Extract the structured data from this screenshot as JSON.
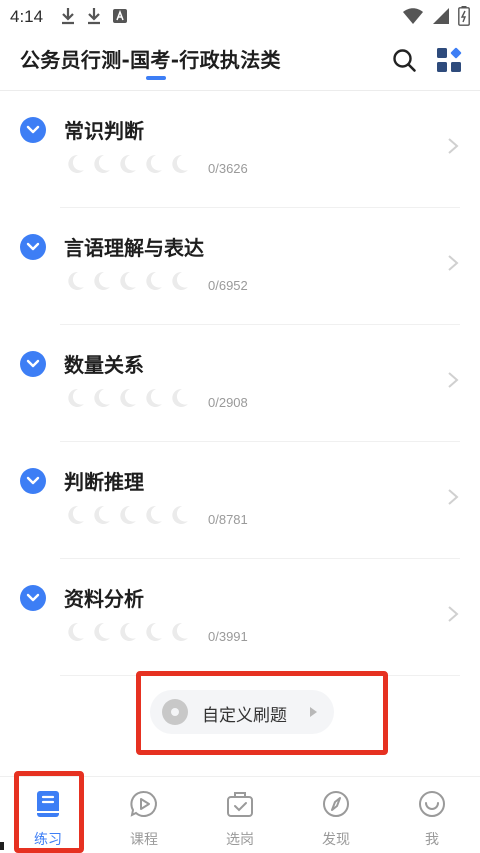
{
  "status_bar": {
    "time": "4:14",
    "left_icons": [
      "download-icon",
      "download-icon",
      "a-notification-icon"
    ],
    "right_icons": [
      "wifi-icon",
      "signal-icon",
      "battery-charging-icon"
    ]
  },
  "header": {
    "title": "公务员行测-国考-行政执法类",
    "actions": [
      "search-icon",
      "grid-apps-icon"
    ]
  },
  "categories": [
    {
      "name": "常识判断",
      "progress": "0/3626",
      "stars": 0,
      "max_stars": 5
    },
    {
      "name": "言语理解与表达",
      "progress": "0/6952",
      "stars": 0,
      "max_stars": 5
    },
    {
      "name": "数量关系",
      "progress": "0/2908",
      "stars": 0,
      "max_stars": 5
    },
    {
      "name": "判断推理",
      "progress": "0/8781",
      "stars": 0,
      "max_stars": 5
    },
    {
      "name": "资料分析",
      "progress": "0/3991",
      "stars": 0,
      "max_stars": 5
    }
  ],
  "custom_practice": {
    "label": "自定义刷题"
  },
  "tabs": [
    {
      "label": "练习",
      "icon": "book-icon",
      "active": true
    },
    {
      "label": "课程",
      "icon": "play-bubble-icon",
      "active": false
    },
    {
      "label": "选岗",
      "icon": "briefcase-check-icon",
      "active": false
    },
    {
      "label": "发现",
      "icon": "compass-icon",
      "active": false
    },
    {
      "label": "我",
      "icon": "smile-icon",
      "active": false
    }
  ],
  "colors": {
    "accent": "#3d7ef5",
    "highlight": "#e63121",
    "muted": "#9a9a9a"
  }
}
